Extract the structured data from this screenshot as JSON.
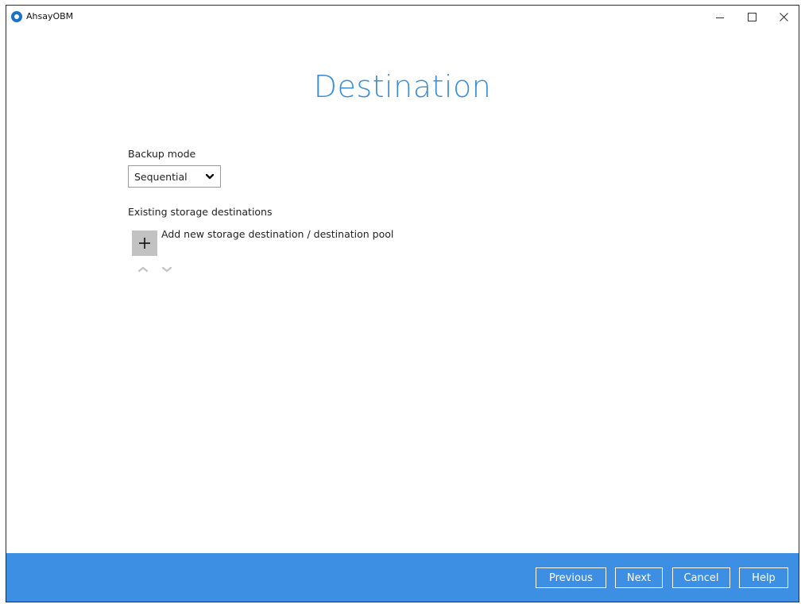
{
  "window": {
    "title": "AhsayOBM"
  },
  "page": {
    "heading": "Destination"
  },
  "backup_mode": {
    "label": "Backup mode",
    "selected": "Sequential"
  },
  "storage": {
    "section_label": "Existing storage destinations",
    "add_label": "Add new storage destination / destination pool"
  },
  "footer": {
    "previous": "Previous",
    "next": "Next",
    "cancel": "Cancel",
    "help": "Help"
  },
  "icons": {
    "app": "ahsay-logo-icon",
    "minimize": "minimize-icon",
    "maximize": "maximize-icon",
    "close": "close-icon",
    "dropdown": "chevron-down-icon",
    "add": "plus-icon",
    "move_up": "chevron-up-icon",
    "move_down": "chevron-down-icon"
  },
  "colors": {
    "accent": "#3c8fd6",
    "footer_bg": "#3c8fe3",
    "add_button_bg": "#c2c2c2"
  }
}
